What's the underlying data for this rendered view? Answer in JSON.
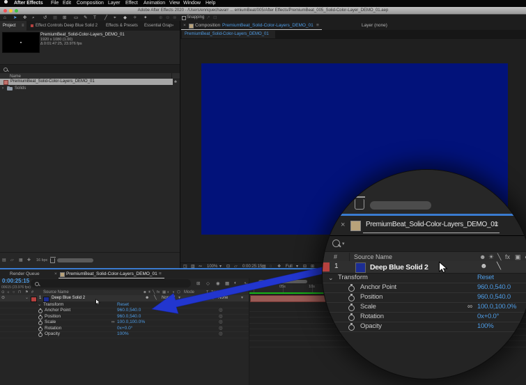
{
  "app": {
    "menu": {
      "items": [
        "After Effects",
        "File",
        "Edit",
        "Composition",
        "Layer",
        "Effect",
        "Animation",
        "View",
        "Window",
        "Help"
      ]
    },
    "title": "Adobe After Effects 2020 - /Users/enriquechavarr ... emiumBeat/005/After Effects/PremiumBeat_005_Solid-Color-Layer_DEMO_01.aep",
    "toolbar": {
      "tools": [
        {
          "name": "home-tool",
          "glyph": "⌂"
        },
        {
          "name": "selection-tool",
          "glyph": "➤"
        },
        {
          "name": "hand-tool",
          "glyph": "✥"
        },
        {
          "name": "zoom-tool",
          "glyph": "⌕"
        },
        {
          "name": "rotate-tool",
          "glyph": "↺"
        },
        {
          "name": "camera-tool",
          "glyph": "▦"
        },
        {
          "name": "pan-behind-tool",
          "glyph": "⊞"
        },
        {
          "name": "shape-tool",
          "glyph": "▭"
        },
        {
          "name": "pen-tool",
          "glyph": "✎"
        },
        {
          "name": "type-tool",
          "glyph": "T"
        },
        {
          "name": "brush-tool",
          "glyph": "╱"
        },
        {
          "name": "stamp-tool",
          "glyph": "⌖"
        },
        {
          "name": "eraser-tool",
          "glyph": "◆"
        },
        {
          "name": "roto-brush-tool",
          "glyph": "✧"
        },
        {
          "name": "puppet-pin-tool",
          "glyph": "✦"
        }
      ],
      "axis_icons": [
        "⊕",
        "⊖",
        "⊗"
      ],
      "snapping_label": "Snapping",
      "extra_icons": [
        "↗",
        "⊡"
      ]
    }
  },
  "ui": {
    "caret": "▾",
    "close": "×",
    "menu": "≡",
    "chevron_down": "⌄",
    "chevron_right": "›",
    "overflow": "»",
    "link": "∞",
    "pickwhip": "◎",
    "flag": "⚑"
  },
  "colors": {
    "accent_blue": "#4f9ee8",
    "deep_blue_solid": "#02127a",
    "arrow_blue": "#2236cf",
    "label_red": "#b5413f",
    "layer_bar_salmon": "#9a5a55",
    "cached_frames_green": "#18b518",
    "active_panel_border": "#3a7bd0"
  },
  "project": {
    "tabs": [
      {
        "label": "Project"
      },
      {
        "label": "Effect Controls Deep Blue Solid 2"
      },
      {
        "label": "Effects & Presets"
      },
      {
        "label": "Essential Grap"
      }
    ],
    "info": {
      "name": "PremiumBeat_Solid-Color-Layers_DEMO_01",
      "dims": "1920 x 1080 (1.00)",
      "duration": "Δ 0:01:47:25, 23.976 fps"
    },
    "name_col": "Name",
    "rows": [
      {
        "label": "PremiumBeat_Solid-Color-Layers_DEMO_01"
      },
      {
        "label": "Solids"
      }
    ],
    "usage_icon": "♣",
    "footer": {
      "depth": "16 bpc",
      "icons": [
        "▤",
        "▱",
        "▦",
        "✚"
      ]
    }
  },
  "viewer": {
    "tab": {
      "prefix": "Composition",
      "name": "PremiumBeat_Solid-Color-Layers_DEMO_01"
    },
    "tab2": "Layer (none)",
    "breadcrumb": "PremiumBeat_Solid-Color-Layers_DEMO_01",
    "footer": {
      "icons_a": [
        "◳",
        "▥",
        "∾"
      ],
      "zoom": "100%",
      "icons_b": [
        "⊡",
        "▱"
      ],
      "timecode": "0:00:25:15",
      "icons_c": [
        "▤",
        "◌",
        "❖"
      ],
      "res": "Full",
      "icons_d": [
        "⊟",
        "⊞"
      ]
    }
  },
  "timeline": {
    "tabs": {
      "render_queue": "Render Queue",
      "comp": "PremiumBeat_Solid-Color-Layers_DEMO_01"
    },
    "timecode": "0:00:25:15",
    "frame_info": "00615 (23.976 fps)",
    "av_icons": [
      "⊙",
      "◃",
      "○",
      "⊓"
    ],
    "option_icons": [
      "⊞",
      "◇",
      "◉",
      "▦",
      "◐",
      "∿"
    ],
    "switch_icons": [
      "☻",
      "☀",
      "╲",
      "fx",
      "▦",
      "◐",
      "◑",
      "⬡"
    ],
    "headers": {
      "num": "#",
      "source": "Source Name",
      "mode": "Mode",
      "t": "T",
      "trkmat": "TrkMat"
    },
    "layer": {
      "num": "1",
      "name": "Deep Blue Solid 2",
      "mode": "Normal",
      "parent": "None"
    },
    "group": {
      "label": "Transform",
      "reset": "Reset"
    },
    "props": [
      {
        "name": "Anchor Point",
        "value": "960.0,540.0"
      },
      {
        "name": "Position",
        "value": "960.0,540.0"
      },
      {
        "name": "Scale",
        "value": "100.0,100.0%"
      },
      {
        "name": "Rotation",
        "value": "0x+0.0°"
      },
      {
        "name": "Opacity",
        "value": "100%"
      }
    ],
    "ruler": [
      "05s",
      "10s"
    ]
  },
  "magnifier": {
    "tab": "PremiumBeat_Solid-Color-Layers_DEMO_01",
    "headers": {
      "num": "#",
      "source": "Source Name"
    },
    "switch_icons": [
      "☻",
      "☀",
      "╲",
      "fx",
      "▣",
      "◐"
    ],
    "layer": {
      "num": "1",
      "name": "Deep Blue Solid 2"
    },
    "group": {
      "label": "Transform",
      "reset": "Reset"
    },
    "props": [
      {
        "name": "Anchor Point",
        "value": "960.0,540.0"
      },
      {
        "name": "Position",
        "value": "960.0,540.0"
      },
      {
        "name": "Scale",
        "value": "100.0,100.0%"
      },
      {
        "name": "Rotation",
        "value": "0x+0.0°"
      },
      {
        "name": "Opacity",
        "value": "100%"
      }
    ]
  }
}
